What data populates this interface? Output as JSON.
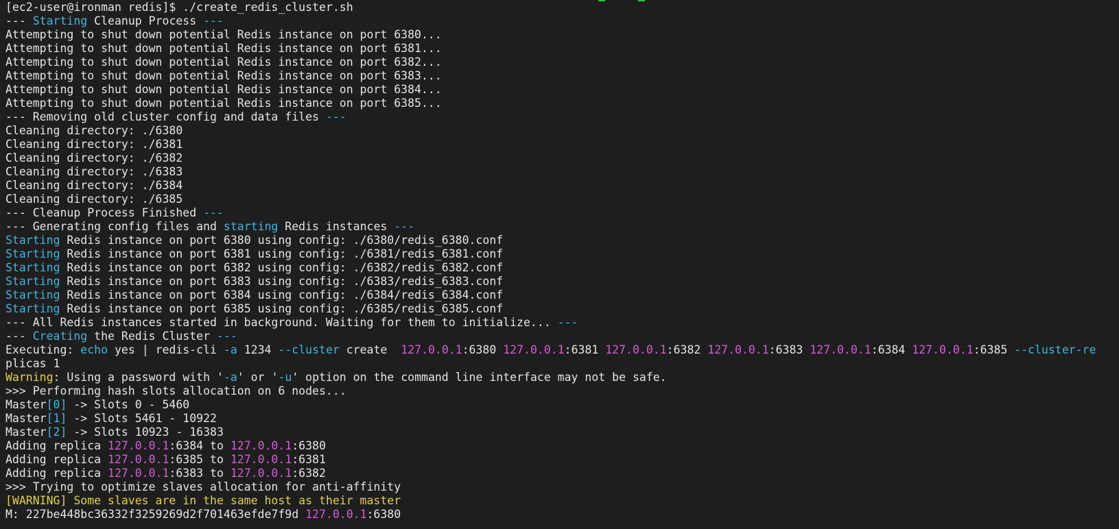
{
  "terminal": {
    "lines": [
      [
        {
          "t": "[ec2-user@ironman redis]$ ./create_redis_cluster.sh",
          "c": ""
        }
      ],
      [
        {
          "t": "--- ",
          "c": ""
        },
        {
          "t": "Starting",
          "c": "cyan"
        },
        {
          "t": " Cleanup Process ",
          "c": ""
        },
        {
          "t": "---",
          "c": "cyan"
        }
      ],
      [
        {
          "t": "Attempting to shut down potential Redis instance on port 6380...",
          "c": ""
        }
      ],
      [
        {
          "t": "Attempting to shut down potential Redis instance on port 6381...",
          "c": ""
        }
      ],
      [
        {
          "t": "Attempting to shut down potential Redis instance on port 6382...",
          "c": ""
        }
      ],
      [
        {
          "t": "Attempting to shut down potential Redis instance on port 6383...",
          "c": ""
        }
      ],
      [
        {
          "t": "Attempting to shut down potential Redis instance on port 6384...",
          "c": ""
        }
      ],
      [
        {
          "t": "Attempting to shut down potential Redis instance on port 6385...",
          "c": ""
        }
      ],
      [
        {
          "t": "--- Removing old cluster config and data files ",
          "c": ""
        },
        {
          "t": "---",
          "c": "cyan"
        }
      ],
      [
        {
          "t": "Cleaning directory: ./6380",
          "c": ""
        }
      ],
      [
        {
          "t": "Cleaning directory: ./6381",
          "c": ""
        }
      ],
      [
        {
          "t": "Cleaning directory: ./6382",
          "c": ""
        }
      ],
      [
        {
          "t": "Cleaning directory: ./6383",
          "c": ""
        }
      ],
      [
        {
          "t": "Cleaning directory: ./6384",
          "c": ""
        }
      ],
      [
        {
          "t": "Cleaning directory: ./6385",
          "c": ""
        }
      ],
      [
        {
          "t": "--- Cleanup Process Finished ",
          "c": ""
        },
        {
          "t": "---",
          "c": "cyan"
        }
      ],
      [
        {
          "t": "--- Generating config files and ",
          "c": ""
        },
        {
          "t": "starting",
          "c": "cyan"
        },
        {
          "t": " Redis instances ",
          "c": ""
        },
        {
          "t": "---",
          "c": "cyan"
        }
      ],
      [
        {
          "t": "Starting",
          "c": "cyan"
        },
        {
          "t": " Redis instance on port 6380 using config: ./6380/redis_6380.conf",
          "c": ""
        }
      ],
      [
        {
          "t": "Starting",
          "c": "cyan"
        },
        {
          "t": " Redis instance on port 6381 using config: ./6381/redis_6381.conf",
          "c": ""
        }
      ],
      [
        {
          "t": "Starting",
          "c": "cyan"
        },
        {
          "t": " Redis instance on port 6382 using config: ./6382/redis_6382.conf",
          "c": ""
        }
      ],
      [
        {
          "t": "Starting",
          "c": "cyan"
        },
        {
          "t": " Redis instance on port 6383 using config: ./6383/redis_6383.conf",
          "c": ""
        }
      ],
      [
        {
          "t": "Starting",
          "c": "cyan"
        },
        {
          "t": " Redis instance on port 6384 using config: ./6384/redis_6384.conf",
          "c": ""
        }
      ],
      [
        {
          "t": "Starting",
          "c": "cyan"
        },
        {
          "t": " Redis instance on port 6385 using config: ./6385/redis_6385.conf",
          "c": ""
        }
      ],
      [
        {
          "t": "--- All Redis instances started in background. Waiting for them to initialize... ",
          "c": ""
        },
        {
          "t": "---",
          "c": "cyan"
        }
      ],
      [
        {
          "t": "--- ",
          "c": ""
        },
        {
          "t": "Creating",
          "c": "cyan"
        },
        {
          "t": " the Redis Cluster ",
          "c": ""
        },
        {
          "t": "---",
          "c": "cyan"
        }
      ],
      [
        {
          "t": "Executing: ",
          "c": ""
        },
        {
          "t": "echo",
          "c": "cyan"
        },
        {
          "t": " yes | redis-cli ",
          "c": ""
        },
        {
          "t": "-a",
          "c": "cyan"
        },
        {
          "t": " 1234 ",
          "c": ""
        },
        {
          "t": "--cluster",
          "c": "cyan"
        },
        {
          "t": " create  ",
          "c": ""
        },
        {
          "t": "127.0.0.1",
          "c": "mag"
        },
        {
          "t": ":6380 ",
          "c": ""
        },
        {
          "t": "127.0.0.1",
          "c": "mag"
        },
        {
          "t": ":6381 ",
          "c": ""
        },
        {
          "t": "127.0.0.1",
          "c": "mag"
        },
        {
          "t": ":6382 ",
          "c": ""
        },
        {
          "t": "127.0.0.1",
          "c": "mag"
        },
        {
          "t": ":6383 ",
          "c": ""
        },
        {
          "t": "127.0.0.1",
          "c": "mag"
        },
        {
          "t": ":6384 ",
          "c": ""
        },
        {
          "t": "127.0.0.1",
          "c": "mag"
        },
        {
          "t": ":6385 ",
          "c": ""
        },
        {
          "t": "--cluster-re",
          "c": "cyan"
        }
      ],
      [
        {
          "t": "plicas 1",
          "c": ""
        }
      ],
      [
        {
          "t": "Warning",
          "c": "yel"
        },
        {
          "t": ": Using a password with '",
          "c": ""
        },
        {
          "t": "-a",
          "c": "cyan"
        },
        {
          "t": "' or '",
          "c": ""
        },
        {
          "t": "-u",
          "c": "cyan"
        },
        {
          "t": "' option on the command line interface may not be safe.",
          "c": ""
        }
      ],
      [
        {
          "t": ">>> Performing hash slots allocation on 6 nodes...",
          "c": ""
        }
      ],
      [
        {
          "t": "Master",
          "c": ""
        },
        {
          "t": "[0]",
          "c": "cyan"
        },
        {
          "t": " -> Slots 0 - 5460",
          "c": ""
        }
      ],
      [
        {
          "t": "Master",
          "c": ""
        },
        {
          "t": "[1]",
          "c": "cyan"
        },
        {
          "t": " -> Slots 5461 - 10922",
          "c": ""
        }
      ],
      [
        {
          "t": "Master",
          "c": ""
        },
        {
          "t": "[2]",
          "c": "cyan"
        },
        {
          "t": " -> Slots 10923 - 16383",
          "c": ""
        }
      ],
      [
        {
          "t": "Adding replica ",
          "c": ""
        },
        {
          "t": "127.0.0.1",
          "c": "mag"
        },
        {
          "t": ":6384 to ",
          "c": ""
        },
        {
          "t": "127.0.0.1",
          "c": "mag"
        },
        {
          "t": ":6380",
          "c": ""
        }
      ],
      [
        {
          "t": "Adding replica ",
          "c": ""
        },
        {
          "t": "127.0.0.1",
          "c": "mag"
        },
        {
          "t": ":6385 to ",
          "c": ""
        },
        {
          "t": "127.0.0.1",
          "c": "mag"
        },
        {
          "t": ":6381",
          "c": ""
        }
      ],
      [
        {
          "t": "Adding replica ",
          "c": ""
        },
        {
          "t": "127.0.0.1",
          "c": "mag"
        },
        {
          "t": ":6383 to ",
          "c": ""
        },
        {
          "t": "127.0.0.1",
          "c": "mag"
        },
        {
          "t": ":6382",
          "c": ""
        }
      ],
      [
        {
          "t": ">>> Trying to optimize slaves allocation for anti-affinity",
          "c": ""
        }
      ],
      [
        {
          "t": "[WARNING] Some slaves are in the same host as their master",
          "c": "yel"
        }
      ],
      [
        {
          "t": "M: 227be448bc36332f3259269d2f701463efde7f9d ",
          "c": ""
        },
        {
          "t": "127.0.0.1",
          "c": "mag"
        },
        {
          "t": ":6380",
          "c": ""
        }
      ]
    ]
  },
  "colors": {
    "background": "#1e1e1e",
    "foreground": "#e6e6e6",
    "cyan": "#3fb6e0",
    "magenta": "#d45cd6",
    "yellow": "#e3d43c"
  }
}
